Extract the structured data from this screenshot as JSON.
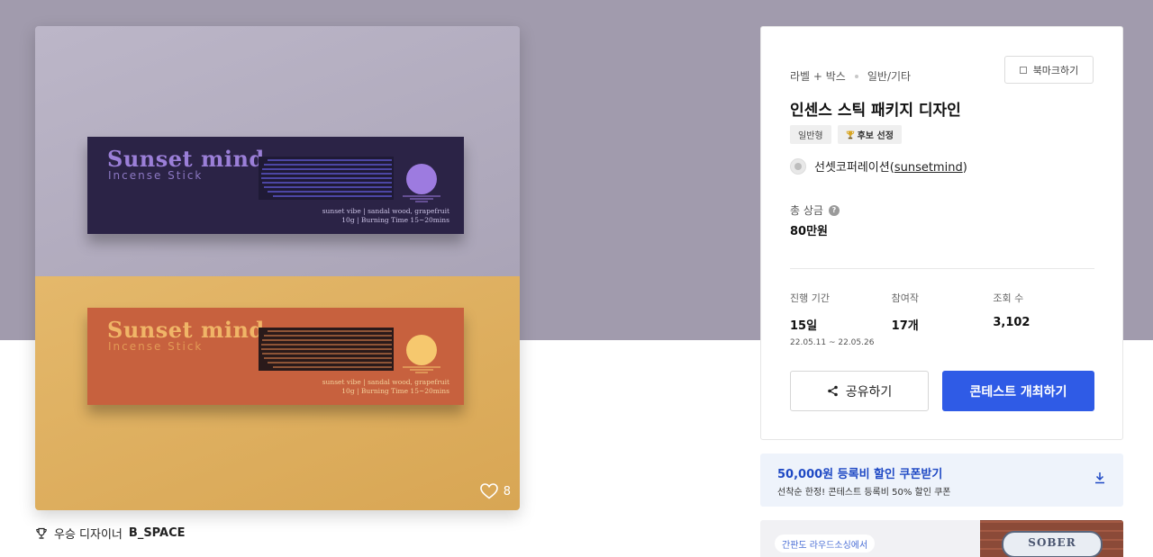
{
  "product": {
    "box_brand": "Sunset mind",
    "box_sub": "Incense Stick",
    "box_fine_line1": "sunset vibe | sandal wood, grapefruit",
    "box_fine_line2": "10g | Burning Time 15~20mins",
    "likes": "8"
  },
  "winner": {
    "label": "우승 디자이너",
    "name": "B_SPACE"
  },
  "contest": {
    "category": "라벨 + 박스",
    "subcategory": "일반/기타",
    "bookmark_label": "북마크하기",
    "title": "인센스 스틱 패키지 디자인",
    "tags": [
      "일반형",
      "후보 선정"
    ],
    "host_name": "선셋코퍼레이션",
    "host_handle": "sunsetmind",
    "prize_label": "총 상금",
    "prize_value": "80만원",
    "stats": {
      "period_label": "진행 기간",
      "period_value": "15일",
      "period_range": "22.05.11 ~ 22.05.26",
      "entries_label": "참여작",
      "entries_value": "17개",
      "views_label": "조회 수",
      "views_value": "3,102"
    },
    "share_label": "공유하기",
    "host_button_label": "콘테스트 개최하기"
  },
  "coupon": {
    "title": "50,000원 등록비 할인 쿠폰받기",
    "description": "선착순 한정! 콘테스트 등록비 50% 할인 쿠폰"
  },
  "ad": {
    "pill_text": "간판도 라우드소싱에서",
    "sign_text": "SOBER"
  },
  "colors": {
    "accent_blue": "#2f5be6",
    "hero_band": "#a19bad",
    "coupon_bg": "#eef3fb"
  }
}
